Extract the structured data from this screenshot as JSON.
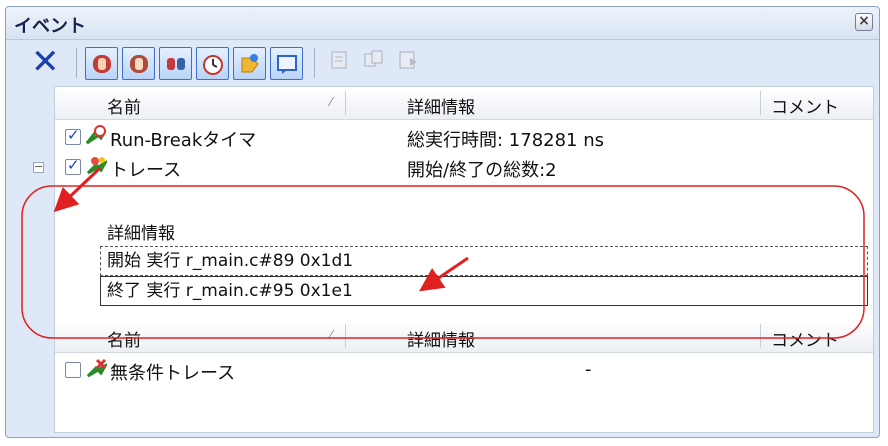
{
  "window": {
    "title": "イベント",
    "close_icon": "close-icon"
  },
  "toolbar": {
    "delete_icon": "delete-x-icon",
    "filter_buttons": [
      {
        "icon": "hardware-break-hand-icon"
      },
      {
        "icon": "software-break-hand-icon"
      },
      {
        "icon": "combination-break-icon"
      },
      {
        "icon": "timer-stopwatch-icon"
      },
      {
        "icon": "trace-event-icon"
      },
      {
        "icon": "printf-event-icon"
      }
    ],
    "disabled_buttons": [
      {
        "icon": "import-icon"
      },
      {
        "icon": "copy-icon"
      },
      {
        "icon": "export-icon"
      }
    ]
  },
  "table": {
    "columns": {
      "name": "名前",
      "detail": "詳細情報",
      "comment": "コメント"
    },
    "rows": [
      {
        "name": "Run-Breakタイマ",
        "detail": "総実行時間: 178281 ns",
        "checked": true
      },
      {
        "name": "トレース",
        "detail": "開始/終了の総数:2",
        "checked": true,
        "expanded": true
      }
    ],
    "detail_section": {
      "label": "詳細情報",
      "items": [
        "開始 実行 r_main.c#89 0x1d1",
        "終了 実行 r_main.c#95 0x1e1"
      ]
    }
  },
  "table2": {
    "columns": {
      "name": "名前",
      "detail": "詳細情報",
      "comment": "コメント"
    },
    "rows": [
      {
        "name": "無条件トレース",
        "detail": "-",
        "checked": false
      }
    ]
  },
  "annotations": {
    "highlight_color": "#e02020"
  }
}
